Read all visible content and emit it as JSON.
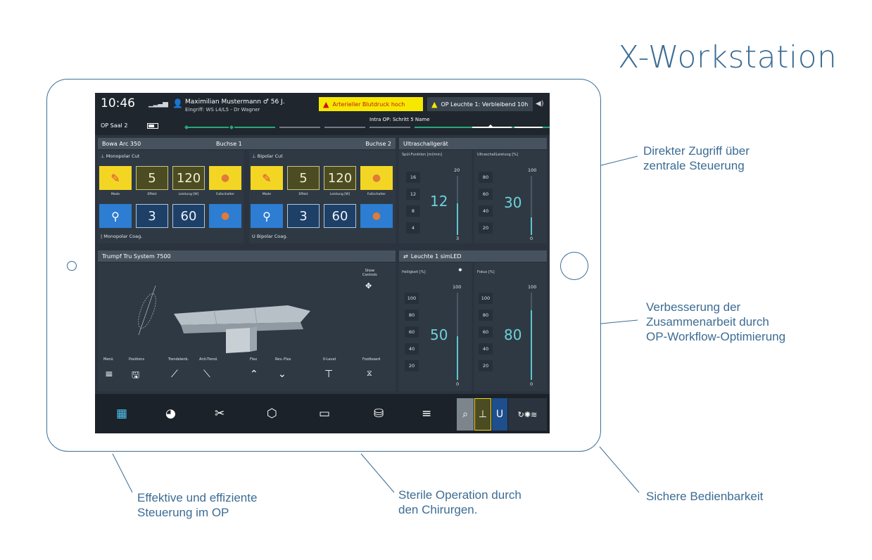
{
  "headline": "X-Workstation",
  "annotations": {
    "direct_access": [
      "Direkter Zugriff über",
      "zentrale Steuerung"
    ],
    "collaboration": [
      "Verbesserung der",
      "Zusammenarbeit durch",
      "OP-Workflow-Optimierung"
    ],
    "effective": [
      "Effektive und effiziente",
      "Steuerung im OP"
    ],
    "sterile": [
      "Sterile Operation durch",
      "den Chirurgen."
    ],
    "safe": [
      "Sichere Bedienbarkeit"
    ]
  },
  "status": {
    "time": "10:46",
    "signal_icon": "signal-bars-icon",
    "patient_name": "Maximilian Mustermann",
    "patient_gender_age": "♂ 56 J.",
    "procedure": "Eingriff: WS L4/L5 - Dr Wagner",
    "alert_primary": "Arterieller Blutdruck hoch",
    "alert_secondary": "OP Leuchte 1: Verbleibend 10h",
    "room": "OP Saal 2",
    "workflow_step": "Intra OP: Schritt 5 Name"
  },
  "bowa": {
    "title": "Bowa Arc 350",
    "socket1": "Buchse 1",
    "socket2": "Buchse 2",
    "mono_cut": "Monopolar Cut",
    "mono_coag": "Monopolar Coag.",
    "bi_cut": "Bipolar Cut",
    "bi_coag": "Bipolar Coag.",
    "labels": {
      "mode": "Mode",
      "effekt": "Effekt",
      "leistung": "Leistung [W]",
      "fussschalter": "Fußschalter"
    },
    "mono": {
      "effekt_cut": "5",
      "leistung_cut": "120",
      "effekt_coag": "3",
      "leistung_coag": "60"
    },
    "bi": {
      "effekt_cut": "5",
      "leistung_cut": "120",
      "effekt_coag": "3",
      "leistung_coag": "60"
    }
  },
  "ultrasound": {
    "title": "Ultraschallgerät",
    "rinse_label": "Spül-Funktion [ml/min]",
    "power_label": "UltraschallLeistung [%]",
    "rinse_value": "12",
    "power_value": "30",
    "rinse_max": "20",
    "rinse_min": "3",
    "power_max": "100",
    "power_min": "0",
    "rinse_scale": [
      "16",
      "12",
      "8",
      "4"
    ],
    "power_scale": [
      "80",
      "60",
      "40",
      "20"
    ],
    "rinse_level": 0.53,
    "power_level": 0.3
  },
  "table": {
    "title": "Trumpf Tru System 7500",
    "show_controls": [
      "Show",
      "Controls"
    ],
    "controls": [
      "Menü",
      "Positions",
      "Trendelenb.",
      "Anti-Trend.",
      "Flex",
      "Rev.-Flex",
      "0-Level",
      "Footboard"
    ]
  },
  "light": {
    "title": "Leuchte 1 simLED",
    "brightness_label": "Helligkeit [%]",
    "focus_label": "Fokus [%]",
    "brightness_value": "50",
    "focus_value": "80",
    "max": "100",
    "min": "0",
    "scale": [
      "100",
      "80",
      "60",
      "40",
      "20"
    ],
    "brightness_level": 0.5,
    "focus_level": 0.8
  },
  "nav": {
    "items": [
      "dashboard-icon",
      "camera-icon",
      "scissors-icon",
      "cube-icon",
      "monitor-icon",
      "database-icon",
      "menu-icon"
    ]
  },
  "colors": {
    "brand_blue": "#3c6c94",
    "screen_bg": "#2b343e",
    "accent_teal": "#5ec6cc",
    "alert_yellow": "#f7e800",
    "workflow_green": "#29a87a"
  }
}
